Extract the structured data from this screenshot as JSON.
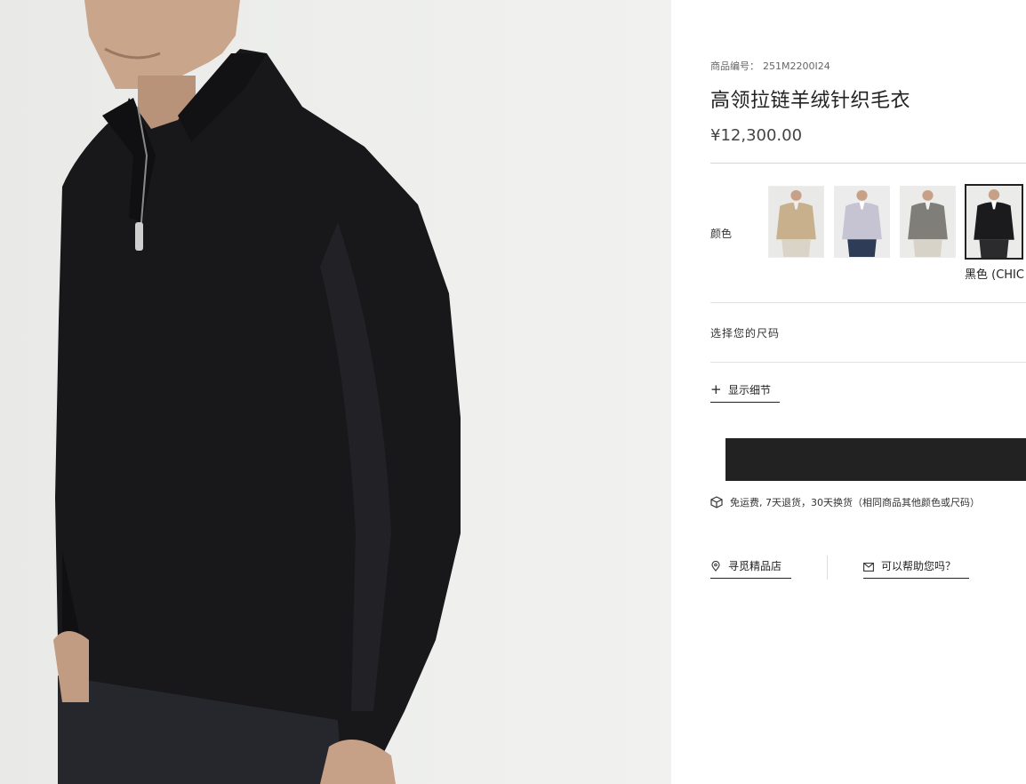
{
  "product": {
    "sku_label": "商品编号：",
    "sku_value": "251M2200I24",
    "title": "高领拉链羊绒针织毛衣",
    "price": "¥12,300.00"
  },
  "color": {
    "label": "颜色",
    "selected_name": "黑色 (CHIC",
    "swatches": [
      {
        "sweater": "#c9b08c",
        "shirt": "#eeeeee",
        "pants": "#d9d3c8",
        "bg": "#e9e9e7"
      },
      {
        "sweater": "#c6c3d3",
        "shirt": "#ffffff",
        "pants": "#2e3c57",
        "bg": "#ececec"
      },
      {
        "sweater": "#7f7e79",
        "shirt": "#f1f1f1",
        "pants": "#d8d3c8",
        "bg": "#ebebea"
      },
      {
        "sweater": "#1b1b1d",
        "shirt": "#ffffff",
        "pants": "#2b2b2d",
        "bg": "#ebebea"
      }
    ]
  },
  "size": {
    "label": "选择您的尺码"
  },
  "details": {
    "plus": "+",
    "label": "显示细节"
  },
  "shipping": {
    "text": "免运费, 7天退货，30天换货（相同商品其他颜色或尺码）"
  },
  "links": {
    "store": "寻觅精品店",
    "help": "可以帮助您吗？"
  }
}
